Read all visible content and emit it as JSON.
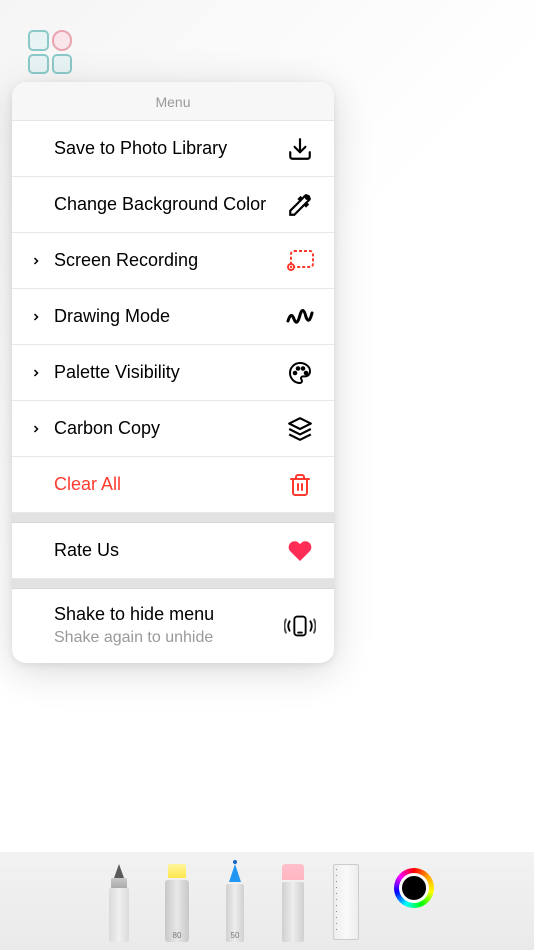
{
  "menu": {
    "title": "Menu",
    "items": [
      {
        "label": "Save to Photo Library",
        "icon": "download-icon",
        "chevron": false
      },
      {
        "label": "Change Background Color",
        "icon": "eyedropper-icon",
        "chevron": false
      },
      {
        "label": "Screen Recording",
        "icon": "record-icon",
        "chevron": true
      },
      {
        "label": "Drawing Mode",
        "icon": "scribble-icon",
        "chevron": true
      },
      {
        "label": "Palette Visibility",
        "icon": "palette-icon",
        "chevron": true
      },
      {
        "label": "Carbon Copy",
        "icon": "layers-icon",
        "chevron": true
      },
      {
        "label": "Clear All",
        "icon": "trash-icon",
        "chevron": false,
        "destructive": true
      }
    ],
    "rateUs": {
      "label": "Rate Us",
      "icon": "heart-icon"
    },
    "shake": {
      "label": "Shake to hide menu",
      "subtitle": "Shake again to unhide",
      "icon": "vibrate-icon"
    }
  },
  "toolbar": {
    "tools": [
      "pen",
      "highlighter",
      "pencil-blue",
      "eraser",
      "ruler"
    ],
    "highlighter_size": "80",
    "pencil_size": "50",
    "currentColor": "#000000"
  }
}
